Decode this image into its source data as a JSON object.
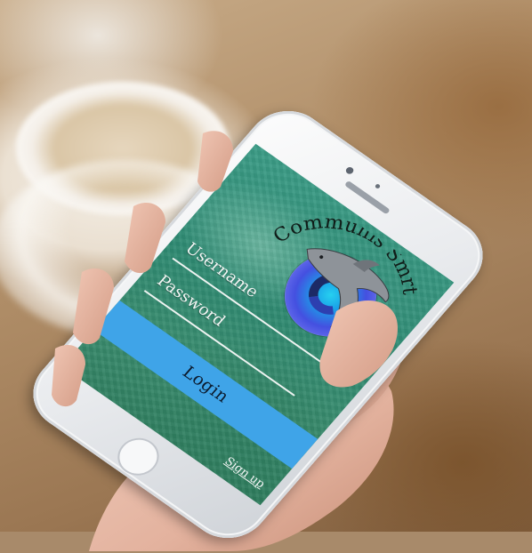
{
  "app": {
    "title": "Communis Smrt"
  },
  "login_form": {
    "username_label": "Username",
    "password_label": "Password",
    "login_button": "Login",
    "signup_link": "Sign up"
  },
  "colors": {
    "screen_bg": "#2e8a72",
    "login_button": "#3fa4e8",
    "emblem_blue": "#4450e0",
    "emblem_cyan": "#26d0f0"
  },
  "icons": {
    "logo": "dolphin-swirl-emblem-icon"
  }
}
